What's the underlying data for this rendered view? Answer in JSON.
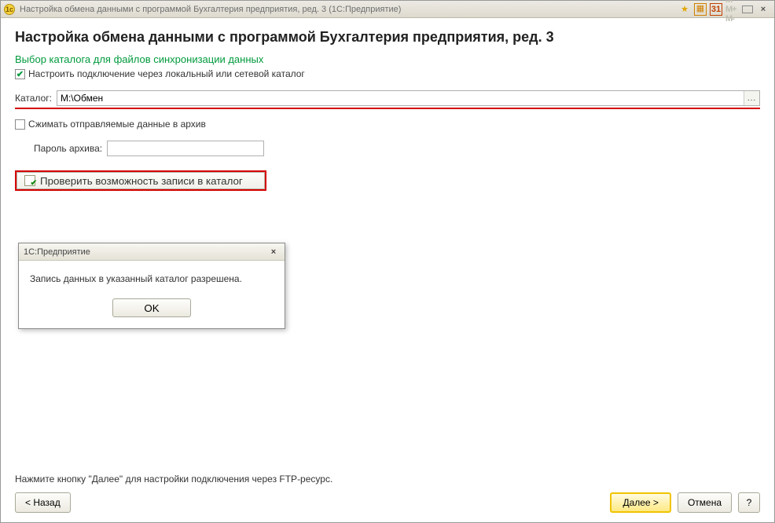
{
  "titlebar": {
    "app_icon_text": "1c",
    "title": "Настройка обмена данными с программой Бухгалтерия предприятия, ред. 3  (1С:Предприятие)",
    "size_labels": "M  M+  M-"
  },
  "page": {
    "title": "Настройка обмена данными с программой Бухгалтерия предприятия, ред. 3",
    "section_title": "Выбор каталога для файлов синхронизации данных"
  },
  "config_via_catalog": {
    "checked": true,
    "label": "Настроить подключение через локальный или сетевой каталог"
  },
  "catalog": {
    "label": "Каталог:",
    "value": "M:\\Обмен",
    "browse_label": "..."
  },
  "compress": {
    "checked": false,
    "label": "Сжимать отправляемые данные в архив"
  },
  "archive_pwd": {
    "label": "Пароль архива:",
    "value": ""
  },
  "check_button": "Проверить возможность записи в каталог",
  "dialog": {
    "title": "1С:Предприятие",
    "message": "Запись данных в указанный каталог разрешена.",
    "ok": "OK"
  },
  "footer": {
    "hint": "Нажмите кнопку \"Далее\" для настройки подключения через FTP-ресурс.",
    "back": "< Назад",
    "next": "Далее >",
    "cancel": "Отмена",
    "help": "?"
  }
}
